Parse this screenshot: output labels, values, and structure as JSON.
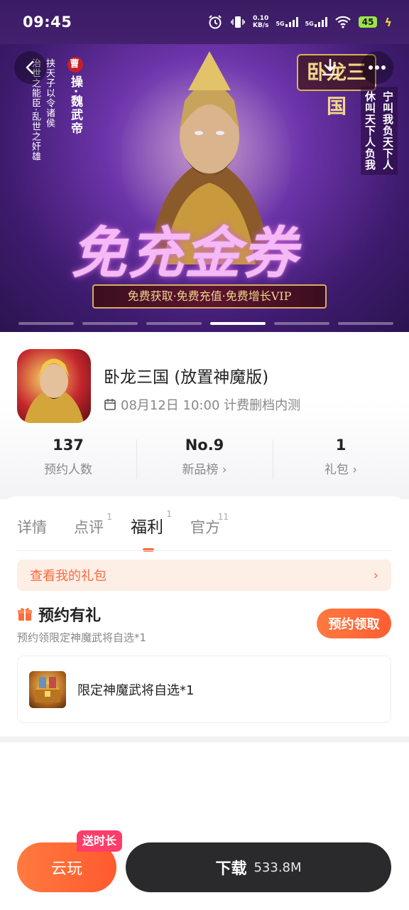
{
  "status_bar": {
    "time": "09:45",
    "speed_value": "0.10",
    "speed_unit": "KB/s",
    "net1": "5G",
    "net2": "5G",
    "battery": "45"
  },
  "banner": {
    "left_text_1": "挟天子以令诸侯",
    "left_text_2": "治世之能臣·乱世之奸雄",
    "name_seal": "曹",
    "name": "操·魏武帝",
    "right_text_1": "宁叫我负天下人",
    "right_text_2": "休叫天下人负我",
    "logo_text": "卧龙三国",
    "title": "免充金券",
    "subtitle": "免费获取·免费充值·免费增长VIP",
    "slide_count": 6,
    "active_slide": 4
  },
  "game": {
    "title": "卧龙三国 (放置神魔版)",
    "date_text": "08月12日 10:00 计费删档内测"
  },
  "stats": [
    {
      "value": "137",
      "label": "预约人数"
    },
    {
      "value": "No.9",
      "label": "新品榜 ›"
    },
    {
      "value": "1",
      "label": "礼包 ›"
    }
  ],
  "tabs": [
    {
      "label": "详情",
      "count": ""
    },
    {
      "label": "点评",
      "count": "1"
    },
    {
      "label": "福利",
      "count": "1"
    },
    {
      "label": "官方",
      "count": "11"
    }
  ],
  "my_gift": {
    "label": "查看我的礼包",
    "arrow": "›"
  },
  "reserve": {
    "title": "预约有礼",
    "desc": "预约领限定神魔武将自选*1",
    "button": "预约领取",
    "item": "限定神魔武将自选*1"
  },
  "bottom": {
    "cloud_label": "云玩",
    "cloud_badge": "送时长",
    "download_label": "下载",
    "download_size": "533.8M"
  },
  "colors": {
    "accent": "#ff6b3d",
    "dark_button": "#2a2a2c",
    "banner_purple": "#6b33a8"
  }
}
